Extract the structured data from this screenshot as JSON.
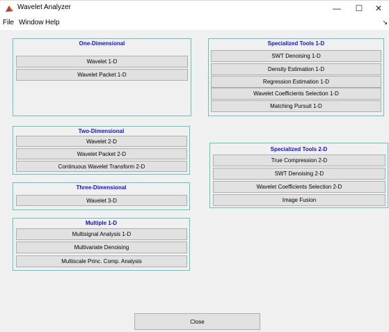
{
  "window": {
    "title": "Wavelet Analyzer",
    "icon": "matlab-icon",
    "controls": {
      "minimize": "—",
      "maximize": "☐",
      "close": "✕"
    }
  },
  "menu": {
    "items": [
      "File",
      "Window",
      "Help"
    ],
    "overflow": "↘"
  },
  "panels": {
    "one_d": {
      "title": "One-Dimensional",
      "buttons": [
        "Wavelet 1-D",
        "Wavelet Packet 1-D"
      ]
    },
    "two_d": {
      "title": "Two-Dimensional",
      "buttons": [
        "Wavelet 2-D",
        "Wavelet Packet 2-D",
        "Continuous Wavelet Transform 2-D"
      ]
    },
    "three_d": {
      "title": "Three-Dimensional",
      "buttons": [
        "Wavelet 3-D"
      ]
    },
    "multiple_1d": {
      "title": "Multiple 1-D",
      "buttons": [
        "Multisignal Analysis 1-D",
        "Multivariate Denoising",
        "Multiscale Princ. Comp. Analysis"
      ]
    },
    "spec_1d": {
      "title": "Specialized Tools 1-D",
      "buttons": [
        "SWT Denoising 1-D",
        "Density Estimation 1-D",
        "Regression Estimation 1-D",
        "Wavelet Coefficients Selection 1-D",
        "Matching Pursuit 1-D"
      ]
    },
    "spec_2d": {
      "title": "Specialized Tools 2-D",
      "buttons": [
        "True Compression 2-D",
        "SWT Denoising 2-D",
        "Wavelet Coefficients Selection 2-D",
        "Image Fusion"
      ]
    }
  },
  "close_label": "Close",
  "colors": {
    "panel_border": "#5fc4c0",
    "panel_title": "#1111dd",
    "background": "#f0f0f0"
  }
}
